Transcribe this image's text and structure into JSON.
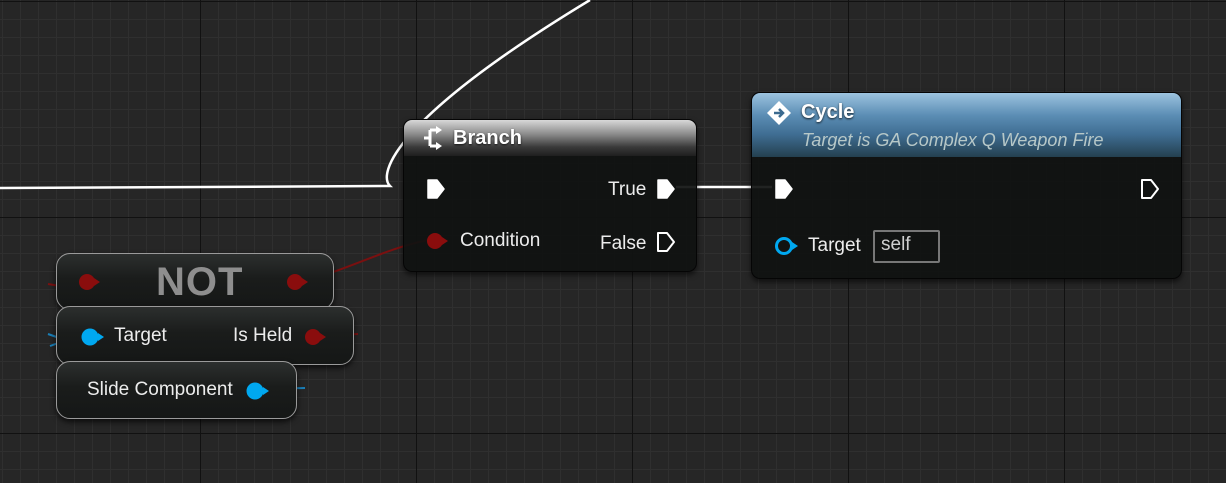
{
  "nodes": {
    "branch": {
      "title": "Branch",
      "pins": {
        "condition_label": "Condition",
        "true_label": "True",
        "false_label": "False"
      }
    },
    "cycle": {
      "title": "Cycle",
      "subtitle": "Target is GA Complex Q Weapon Fire",
      "pins": {
        "target_label": "Target",
        "target_value": "self"
      }
    },
    "not": {
      "title": "NOT"
    },
    "is_held": {
      "target_label": "Target",
      "output_label": "Is Held"
    },
    "slide_component": {
      "label": "Slide Component"
    }
  },
  "icons": {
    "branch": "branch-icon",
    "cycle": "function-diamond-icon",
    "exec": "exec-pin-icon",
    "data": "data-pin-icon"
  },
  "colors": {
    "exec_wire": "#ffffff",
    "bool_pin": "#8a0d0d",
    "object_pin": "#00a8f0",
    "cycle_header": "#4a7ba0",
    "branch_header": "#8a8a8a"
  }
}
